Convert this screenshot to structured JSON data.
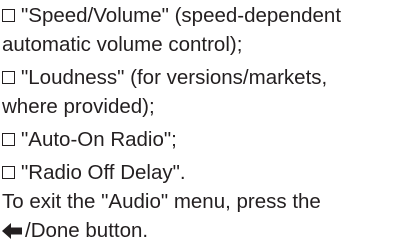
{
  "items": [
    {
      "line1": "\"Speed/Volume\" (speed-dependent",
      "line2": "automatic volume control);"
    },
    {
      "line1": "\"Loudness\" (for versions/markets,",
      "line2": "where provided);"
    },
    {
      "line1": "\"Auto-On Radio\";"
    },
    {
      "line1": "\"Radio Off Delay\"."
    }
  ],
  "footer": {
    "line1": "To exit the \"Audio\" menu, press the",
    "line2": "/Done button."
  },
  "icons": {
    "bullet": "checkbox-square-icon",
    "back": "back-arrow-icon"
  }
}
